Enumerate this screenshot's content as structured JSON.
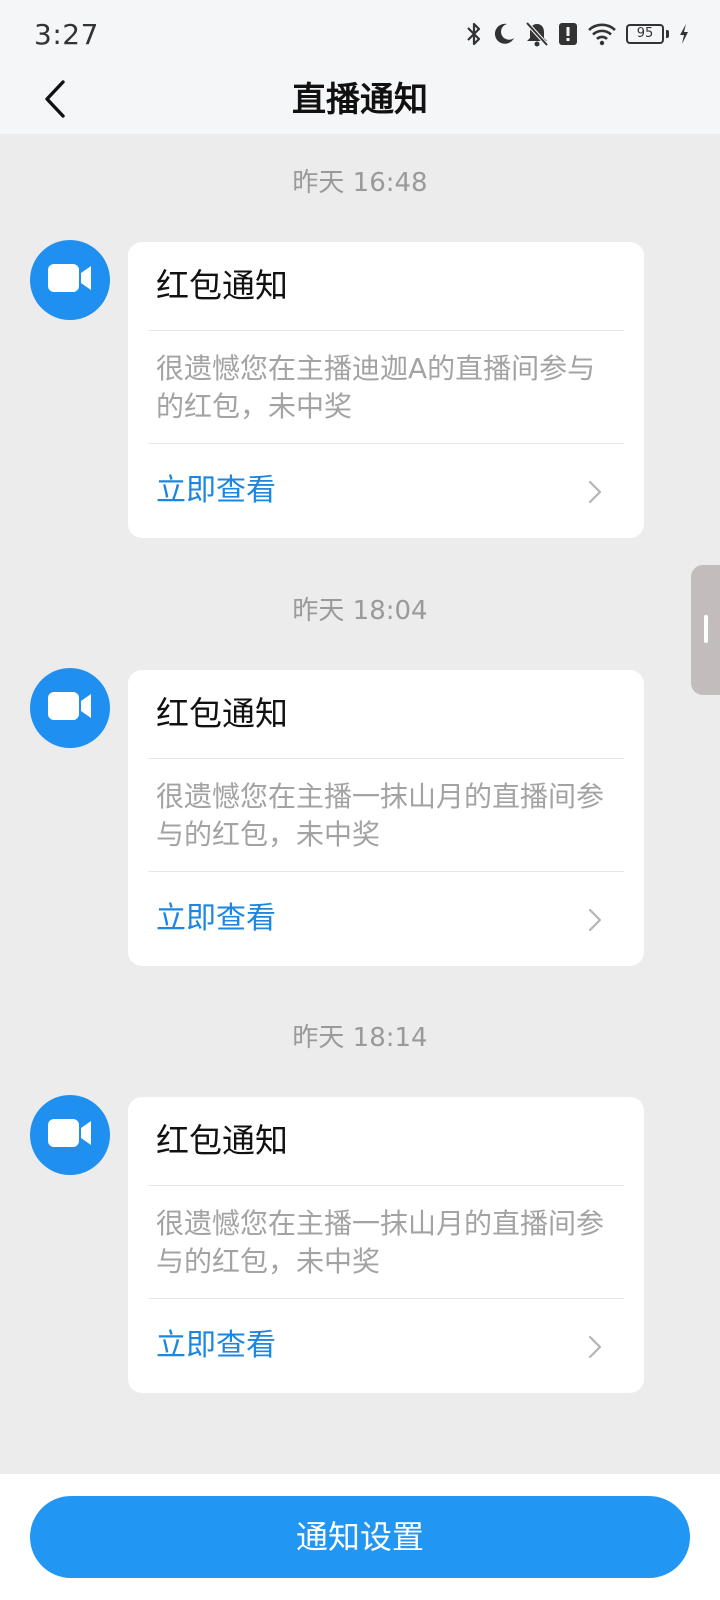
{
  "status_bar": {
    "time": "3:27",
    "battery_level": "95",
    "icons": [
      "bluetooth-icon",
      "moon-icon",
      "bell-off-icon",
      "alert-icon",
      "wifi-icon",
      "battery-icon",
      "charging-icon"
    ]
  },
  "header": {
    "title": "直播通知",
    "back_icon": "chevron-left-icon"
  },
  "messages": [
    {
      "timestamp": "昨天 16:48",
      "title": "红包通知",
      "description": "很遗憾您在主播迪迦A的直播间参与的红包，未中奖",
      "link_label": "立即查看"
    },
    {
      "timestamp": "昨天 18:04",
      "title": "红包通知",
      "description": "很遗憾您在主播一抹山月的直播间参与的红包，未中奖",
      "link_label": "立即查看"
    },
    {
      "timestamp": "昨天 18:14",
      "title": "红包通知",
      "description": "很遗憾您在主播一抹山月的直播间参与的红包，未中奖",
      "link_label": "立即查看"
    }
  ],
  "footer": {
    "settings_button_label": "通知设置"
  },
  "colors": {
    "accent": "#2196f3",
    "link": "#1c86e0",
    "avatar": "#1f8ff0",
    "background": "#ececec"
  }
}
